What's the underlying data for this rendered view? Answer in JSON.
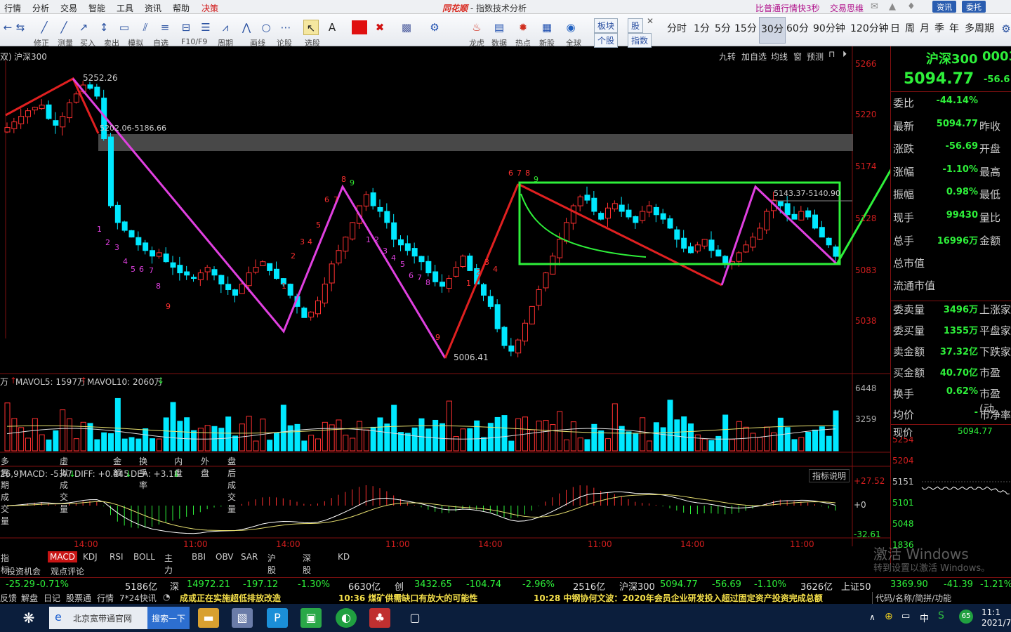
{
  "menu": {
    "items": [
      "行情",
      "分析",
      "交易",
      "智能",
      "工具",
      "资讯",
      "帮助",
      "决策"
    ],
    "title_brand": "同花顺",
    "title_sep": " - ",
    "title_rest": "指数技术分析",
    "promo": "比普通行情快3秒",
    "trade": "交易思维",
    "btn_info": "资讯",
    "btn_entrust": "委托"
  },
  "toolbar": {
    "labels": [
      "修正",
      "测量",
      "买入",
      "卖出",
      "模拟",
      "自选",
      "F10/F9",
      "周期",
      "画线",
      "论股",
      "选股"
    ],
    "right_labels": [
      "龙虎",
      "数据",
      "热点",
      "新股",
      "全球"
    ],
    "mini_top": [
      "板块",
      "股"
    ],
    "mini_bottom": [
      "个股",
      "指数"
    ],
    "periods": [
      "分时",
      "1分",
      "5分",
      "15分",
      "30分",
      "60分",
      "90分钟",
      "120分钟",
      "日",
      "周",
      "月",
      "季",
      "年",
      "多周期"
    ],
    "active_period": "30分"
  },
  "chart": {
    "title": "沪深300",
    "title_prefix": "双)",
    "top_right_buttons": [
      "九转",
      "加自选",
      "均线",
      "窗",
      "预测"
    ],
    "high_label": "5252.26",
    "band_label": "5202.06-5186.66",
    "low_label": "5006.41",
    "box_label": "5143.37-5140.90",
    "price_axis": [
      "5266",
      "5220",
      "5174",
      "5128",
      "5083",
      "5038"
    ],
    "vol_header": {
      "unit": "万",
      "mavol5": "MAVOL5: 1597万",
      "mavol10": "MAVOL10: 2060万"
    },
    "vol_axis": [
      "6448",
      "3259"
    ],
    "vol_tabs": [
      "多周期成交量",
      "虚拟成交量",
      "金额",
      "换手率",
      "内盘",
      "外盘",
      "盘后成交量"
    ],
    "macd_header": {
      "params": "26,9)",
      "macd": "MACD: -5.47",
      "diff": "DIFF: +0.445",
      "dea": "DEA: +3.18"
    },
    "macd_axis": [
      "+27.52",
      "+0",
      "-32.61"
    ],
    "macd_help": "指标说明",
    "time_axis": [
      "14:00",
      "11:00",
      "14:00",
      "11:00",
      "14:00",
      "11:00",
      "14:00",
      "11:00"
    ],
    "indicator_tabs": [
      "指标广场",
      "MACD",
      "KDJ",
      "RSI",
      "BOLL",
      "主力",
      "BBI",
      "OBV",
      "SAR",
      "沪股通",
      "深股通",
      "KD"
    ],
    "active_indicator": "MACD",
    "sub_tabs": [
      "投资机会",
      "观点评论"
    ]
  },
  "chart_data": {
    "type": "candlestick",
    "title": "沪深300",
    "period": "30分",
    "ylim": [
      5000,
      5270
    ],
    "annotations": {
      "high": 5252.26,
      "low": 5006.41,
      "band": [
        5202.06,
        5186.66
      ],
      "box": [
        5143.37,
        5140.9
      ]
    },
    "ohlc_note": "30-minute candles; close of last bar 5094.77",
    "closes": [
      5210,
      5215,
      5220,
      5225,
      5228,
      5230,
      5218,
      5212,
      5220,
      5232,
      5240,
      5248,
      5245,
      5238,
      5200,
      5140,
      5125,
      5118,
      5112,
      5105,
      5100,
      5095,
      5098,
      5090,
      5085,
      5080,
      5078,
      5075,
      5080,
      5085,
      5078,
      5070,
      5065,
      5060,
      5070,
      5080,
      5085,
      5090,
      5082,
      5075,
      5070,
      5060,
      5050,
      5040,
      5045,
      5055,
      5070,
      5088,
      5100,
      5112,
      5125,
      5140,
      5150,
      5140,
      5135,
      5125,
      5110,
      5105,
      5100,
      5095,
      5090,
      5080,
      5072,
      5068,
      5075,
      5085,
      5095,
      5082,
      5070,
      5060,
      5050,
      5030,
      5015,
      5010,
      5020,
      5035,
      5050,
      5065,
      5080,
      5095,
      5110,
      5125,
      5140,
      5148,
      5145,
      5135,
      5128,
      5138,
      5142,
      5135,
      5130,
      5125,
      5135,
      5140,
      5132,
      5128,
      5120,
      5110,
      5102,
      5098,
      5105,
      5110,
      5100,
      5095,
      5088,
      5090,
      5098,
      5105,
      5112,
      5120,
      5135,
      5145,
      5140,
      5132,
      5128,
      5135,
      5130,
      5120,
      5112,
      5105,
      5094.77
    ],
    "volume_axis": [
      3259,
      6448
    ],
    "macd": {
      "macd": -5.47,
      "diff": 0.445,
      "dea": 3.18,
      "ylim": [
        -32.61,
        27.52
      ]
    }
  },
  "sidebar": {
    "name": "沪深300",
    "code": "0003",
    "price": "5094.77",
    "change": "-56.6",
    "rows": [
      {
        "k": "委比",
        "v": "-44.14%",
        "k2": ""
      },
      {
        "k": "最新",
        "v": "5094.77",
        "k2": "昨收"
      },
      {
        "k": "涨跌",
        "v": "-56.69",
        "k2": "开盘"
      },
      {
        "k": "涨幅",
        "v": "-1.10%",
        "k2": "最高"
      },
      {
        "k": "振幅",
        "v": "0.98%",
        "k2": "最低"
      },
      {
        "k": "现手",
        "v": "99430",
        "k2": "量比"
      },
      {
        "k": "总手",
        "v": "16996万",
        "k2": "金额"
      }
    ],
    "rows2": [
      {
        "k": "总市值",
        "v": "",
        "k2": ""
      },
      {
        "k": "流通市值",
        "v": "",
        "k2": ""
      }
    ],
    "rows3": [
      {
        "k": "委卖量",
        "v": "3496万",
        "k2": "上涨家"
      },
      {
        "k": "委买量",
        "v": "1355万",
        "k2": "平盘家"
      },
      {
        "k": "卖金额",
        "v": "37.32亿",
        "k2": "下跌家"
      },
      {
        "k": "买金额",
        "v": "40.70亿",
        "k2": "市盈"
      },
      {
        "k": "换手",
        "v": "0.62%",
        "k2": "市盈(动"
      },
      {
        "k": "均价",
        "v": "-",
        "k2": "市净率"
      }
    ],
    "mini": {
      "label": "现价",
      "value": "5094.77",
      "axis": [
        "5254",
        "5204",
        "5151",
        "5101",
        "5048",
        "1836"
      ]
    }
  },
  "ticker": {
    "items": [
      {
        "t": "-25.29",
        "c": "g"
      },
      {
        "t": "-0.71%",
        "c": "g"
      },
      {
        "t": "5186亿",
        "c": "w"
      },
      {
        "t": "深",
        "c": "w"
      },
      {
        "t": "14972.21",
        "c": "g"
      },
      {
        "t": "-197.12",
        "c": "g"
      },
      {
        "t": "-1.30%",
        "c": "g"
      },
      {
        "t": "6630亿",
        "c": "w"
      },
      {
        "t": "创",
        "c": "w"
      },
      {
        "t": "3432.65",
        "c": "g"
      },
      {
        "t": "-104.74",
        "c": "g"
      },
      {
        "t": "-2.96%",
        "c": "g"
      },
      {
        "t": "2516亿",
        "c": "w"
      },
      {
        "t": "沪深300",
        "c": "w"
      },
      {
        "t": "5094.77",
        "c": "g"
      },
      {
        "t": "-56.69",
        "c": "g"
      },
      {
        "t": "-1.10%",
        "c": "g"
      },
      {
        "t": "3626亿",
        "c": "w"
      },
      {
        "t": "上证50",
        "c": "w"
      },
      {
        "t": "3369.90",
        "c": "g"
      },
      {
        "t": "-41.39",
        "c": "g"
      },
      {
        "t": "-1.21%",
        "c": "g"
      }
    ]
  },
  "news": {
    "left": [
      "反馈",
      "解盘",
      "日记",
      "股票通",
      "行情",
      "7*24快讯"
    ],
    "n1": "成或正在实施超低排放改造",
    "n2": "10:36 煤矿供需缺口有放大的可能性",
    "n3": "10:28 中钢协何文波：2020年会员企业研发投入超过固定资产投资完成总额",
    "search": "代码/名称/简拼/功能"
  },
  "watermark": {
    "l1": "激活 Windows",
    "l2": "转到设置以激活 Windows。"
  },
  "taskbar": {
    "browser_tab": "北京宽带通官网",
    "search_btn": "搜索一下",
    "time": "11:1",
    "date": "2021/7"
  },
  "colors": {
    "up": "#ff3030",
    "down": "#00e8ff",
    "green_line": "#2ef03a",
    "magenta": "#e040e0",
    "red_trend": "#e02020"
  }
}
